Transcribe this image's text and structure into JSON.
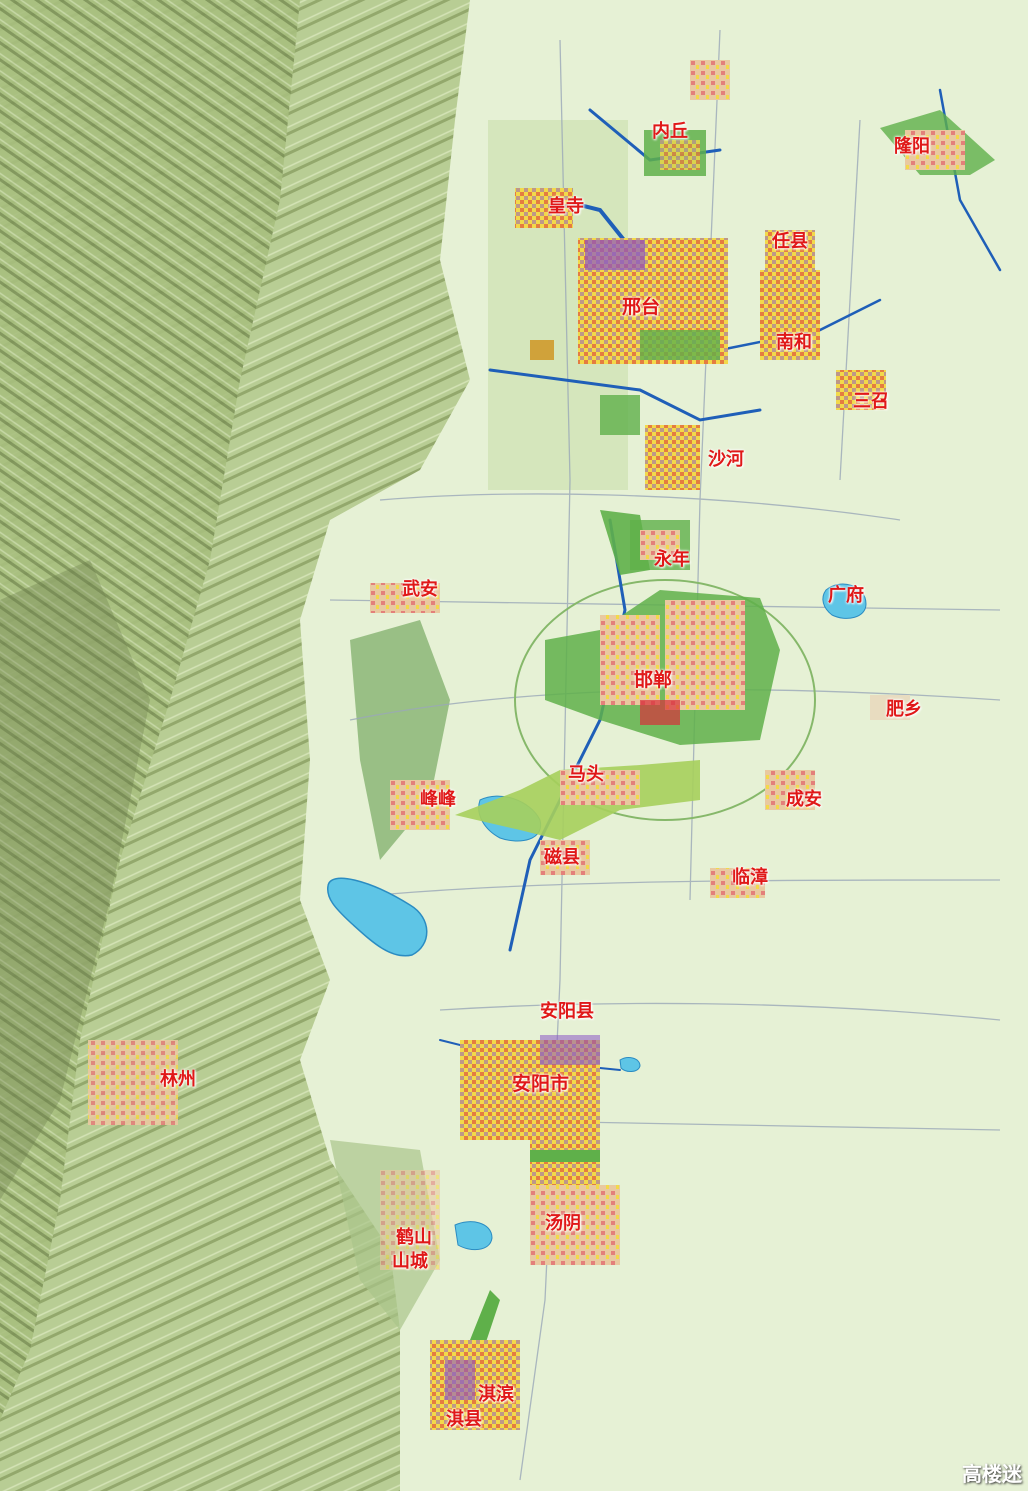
{
  "map": {
    "colors": {
      "plain": "#e6f1d5",
      "mountain_dark": "#6e7f4e",
      "mountain_light": "#b9cf92",
      "river": "#1f5fb8",
      "lake": "#5ec5e6",
      "urban_green": "#5fb04a",
      "urban_yellow": "#f2d94a",
      "urban_red": "#d8303a",
      "urban_purple": "#8a56c6",
      "label": "#e01818"
    },
    "cities": [
      {
        "name": "内丘"
      },
      {
        "name": "隆阳"
      },
      {
        "name": "皇寺"
      },
      {
        "name": "任县"
      },
      {
        "name": "邢台"
      },
      {
        "name": "南和"
      },
      {
        "name": "三召"
      },
      {
        "name": "沙河"
      },
      {
        "name": "永年"
      },
      {
        "name": "武安"
      },
      {
        "name": "广府"
      },
      {
        "name": "邯郸"
      },
      {
        "name": "肥乡"
      },
      {
        "name": "马头"
      },
      {
        "name": "峰峰"
      },
      {
        "name": "成安"
      },
      {
        "name": "磁县"
      },
      {
        "name": "临漳"
      },
      {
        "name": "安阳县"
      },
      {
        "name": "林州"
      },
      {
        "name": "安阳市"
      },
      {
        "name": "汤阴"
      },
      {
        "name": "鹤山"
      },
      {
        "name": "山城"
      },
      {
        "name": "淇滨"
      },
      {
        "name": "淇县"
      }
    ],
    "watermark": "高楼迷"
  }
}
